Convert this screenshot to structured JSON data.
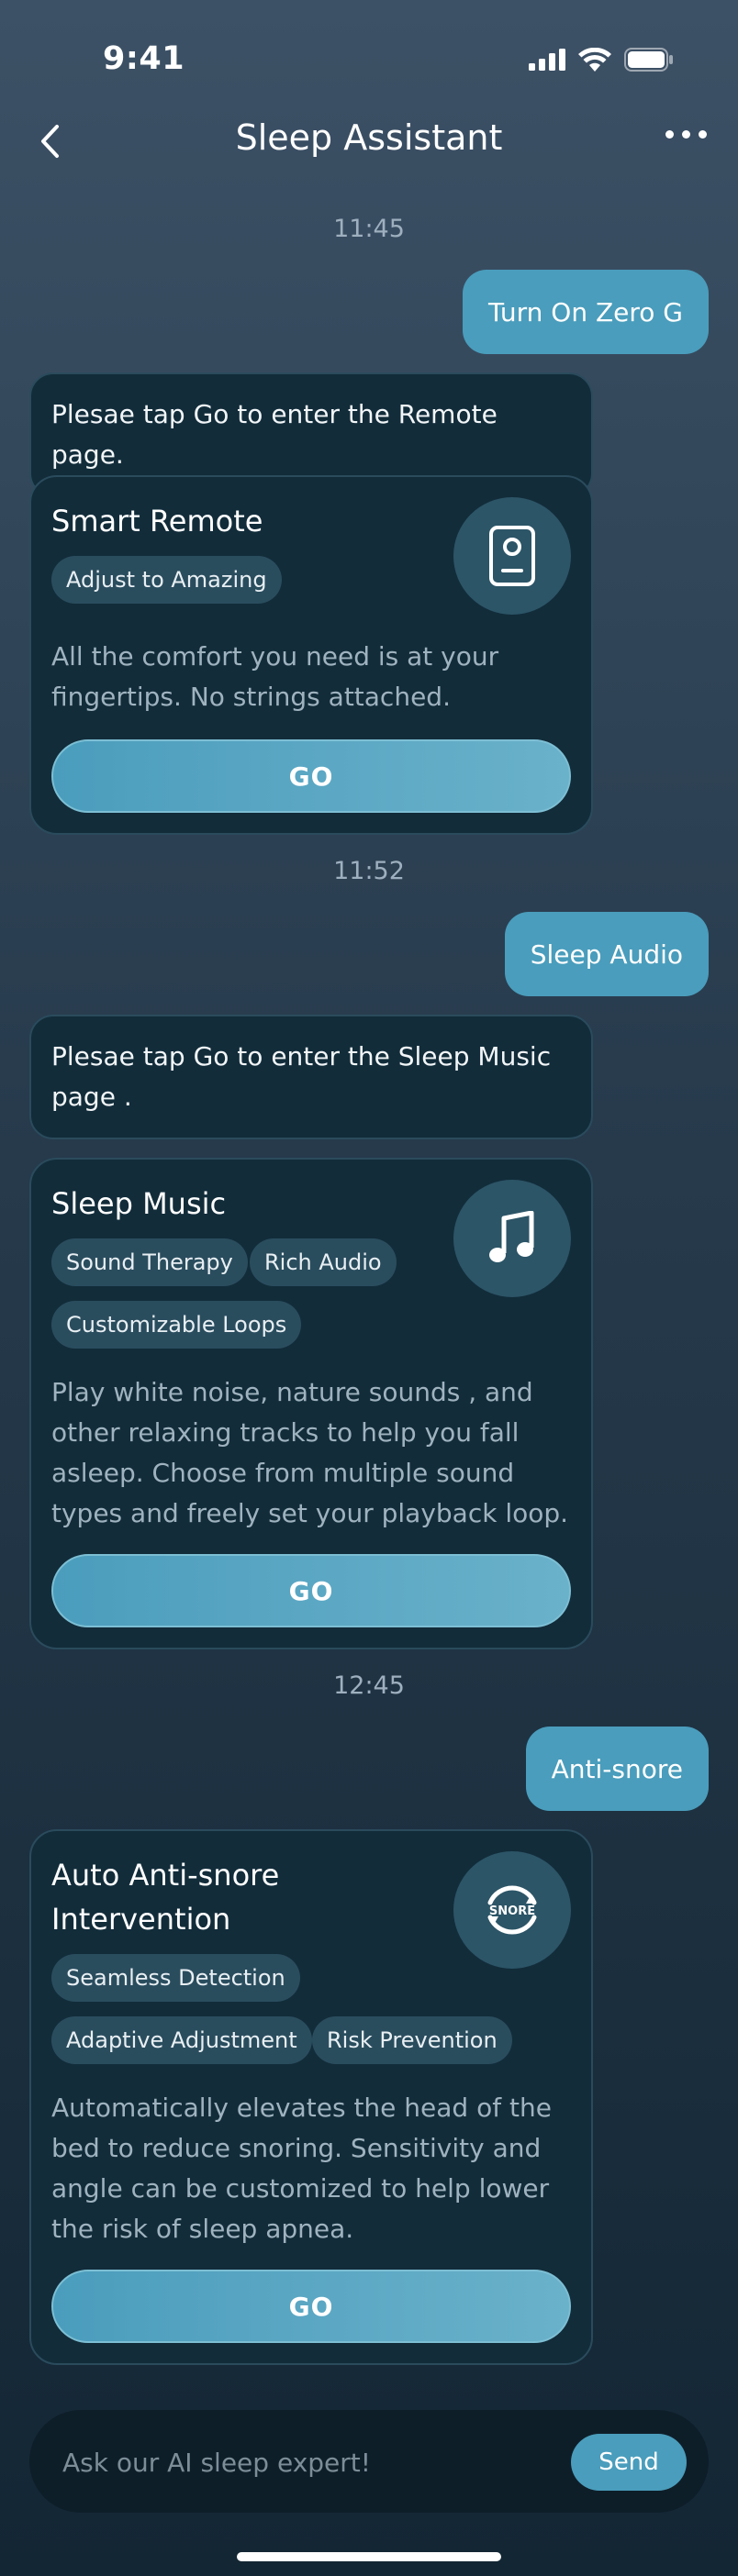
{
  "status_bar": {
    "time": "9:41"
  },
  "nav": {
    "title": "Sleep Assistant"
  },
  "conversation": [
    {
      "timestamp": "11:45",
      "user_message": "Turn On Zero G",
      "bot_message": "Plesae tap Go to enter the Remote page.",
      "card": {
        "title": "Smart Remote",
        "icon": "remote-icon",
        "tags": [
          "Adjust to Amazing"
        ],
        "description": "All the comfort you need is at your fingertips. No strings attached.",
        "button": "GO"
      }
    },
    {
      "timestamp": "11:52",
      "user_message": "Sleep Audio",
      "bot_message": "Plesae tap Go to enter the Sleep Music page .",
      "card": {
        "title": "Sleep Music",
        "icon": "music-note-icon",
        "tags": [
          "Sound Therapy",
          "Rich Audio",
          "Customizable Loops"
        ],
        "description": "Play white noise, nature sounds , and other relaxing tracks to help you fall asleep. Choose from multiple sound types and freely set your playback loop.",
        "button": "GO"
      }
    },
    {
      "timestamp": "12:45",
      "user_message": "Anti-snore",
      "card": {
        "title": "Auto Anti-snore Intervention",
        "icon": "snore-icon",
        "icon_text": "SNORE",
        "tags": [
          "Seamless Detection",
          "Adaptive Adjustment",
          "Risk Prevention"
        ],
        "description": "Automatically elevates the head of the bed to reduce snoring. Sensitivity and angle can be customized to help lower the risk of sleep apnea.",
        "button": "GO"
      }
    }
  ],
  "composer": {
    "placeholder": "Ask our AI sleep expert!",
    "send_label": "Send"
  },
  "colors": {
    "accent": "#4a9dbc",
    "card_bg": "#122c3a",
    "tag_bg": "#2a4d5e"
  }
}
